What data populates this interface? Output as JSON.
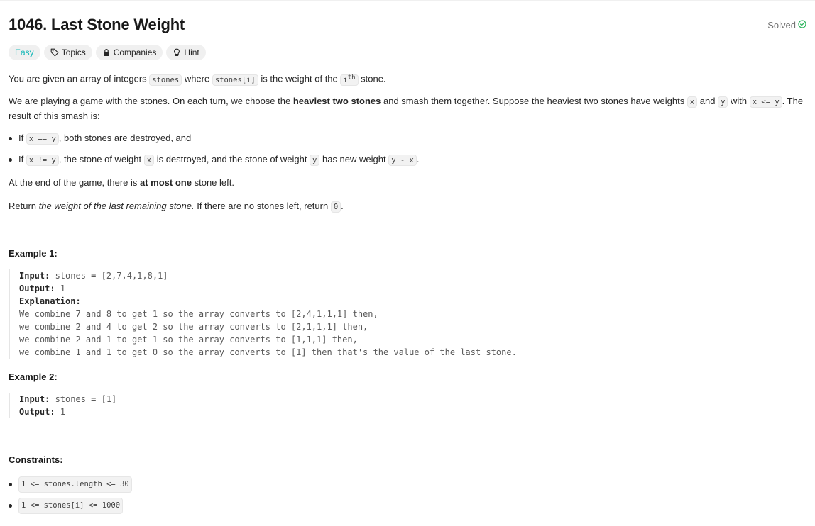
{
  "problem": {
    "title": "1046. Last Stone Weight",
    "status": "Solved",
    "status_color": "#2db55d"
  },
  "tags": {
    "difficulty": "Easy",
    "difficulty_color": "#1cbaba",
    "topics": "Topics",
    "companies": "Companies",
    "hint": "Hint"
  },
  "description": {
    "p1_a": "You are given an array of integers ",
    "p1_code1": "stones",
    "p1_b": " where ",
    "p1_code2": "stones[i]",
    "p1_c": " is the weight of the ",
    "p1_code3": "i",
    "p1_sup": "th",
    "p1_d": " stone.",
    "p2_a": "We are playing a game with the stones. On each turn, we choose the ",
    "p2_bold": "heaviest two stones",
    "p2_b": " and smash them together. Suppose the heaviest two stones have weights ",
    "p2_code1": "x",
    "p2_c": " and ",
    "p2_code2": "y",
    "p2_d": " with ",
    "p2_code3": "x <= y",
    "p2_e": ". The result of this smash is:",
    "b1_a": "If ",
    "b1_code": "x == y",
    "b1_b": ", both stones are destroyed, and",
    "b2_a": "If ",
    "b2_code1": "x != y",
    "b2_b": ", the stone of weight ",
    "b2_code2": "x",
    "b2_c": " is destroyed, and the stone of weight ",
    "b2_code3": "y",
    "b2_d": " has new weight ",
    "b2_code4": "y - x",
    "b2_e": ".",
    "p3_a": "At the end of the game, there is ",
    "p3_bold": "at most one",
    "p3_b": " stone left.",
    "p4_a": "Return ",
    "p4_em": "the weight of the last remaining stone.",
    "p4_b": " If there are no stones left, return ",
    "p4_code": "0",
    "p4_c": "."
  },
  "examples": [
    {
      "heading": "Example 1:",
      "input_label": "Input:",
      "input_value": " stones = [2,7,4,1,8,1]",
      "output_label": "Output:",
      "output_value": " 1",
      "explanation_label": "Explanation:",
      "explanation_lines": [
        "We combine 7 and 8 to get 1 so the array converts to [2,4,1,1,1] then,",
        "we combine 2 and 4 to get 2 so the array converts to [2,1,1,1] then,",
        "we combine 2 and 1 to get 1 so the array converts to [1,1,1] then,",
        "we combine 1 and 1 to get 0 so the array converts to [1] then that's the value of the last stone."
      ]
    },
    {
      "heading": "Example 2:",
      "input_label": "Input:",
      "input_value": " stones = [1]",
      "output_label": "Output:",
      "output_value": " 1"
    }
  ],
  "constraints": {
    "heading": "Constraints:",
    "items": [
      "1 <= stones.length <= 30",
      "1 <= stones[i] <= 1000"
    ]
  },
  "icons": {
    "solved": "check-circle-icon",
    "topics": "tag-icon",
    "companies": "lock-icon",
    "hint": "lightbulb-icon"
  }
}
